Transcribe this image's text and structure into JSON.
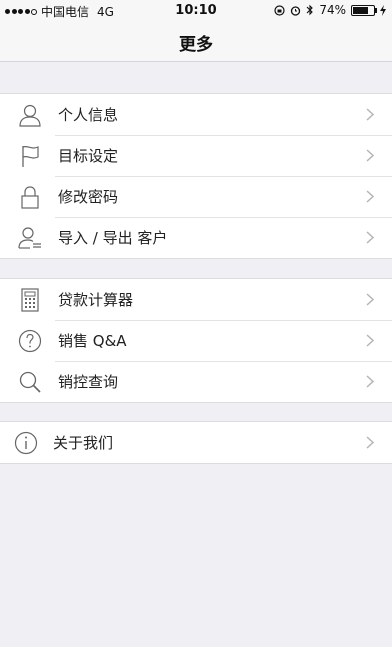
{
  "status_bar": {
    "carrier": "中国电信",
    "network": "4G",
    "time": "10:10",
    "battery": "74%"
  },
  "nav": {
    "title": "更多"
  },
  "groups": [
    {
      "items": [
        {
          "label": "个人信息",
          "icon": "person-icon"
        },
        {
          "label": "目标设定",
          "icon": "flag-icon"
        },
        {
          "label": "修改密码",
          "icon": "lock-icon"
        },
        {
          "label": "导入 / 导出 客户",
          "icon": "contact-import-export-icon"
        }
      ]
    },
    {
      "items": [
        {
          "label": "贷款计算器",
          "icon": "calculator-icon"
        },
        {
          "label": "销售 Q&A",
          "icon": "question-icon"
        },
        {
          "label": "销控查询",
          "icon": "search-icon"
        }
      ]
    },
    {
      "items": [
        {
          "label": "关于我们",
          "icon": "info-icon"
        }
      ]
    }
  ],
  "colors": {
    "background": "#efeff4",
    "icon_stroke": "#666666",
    "chevron": "#b5b5ba"
  }
}
